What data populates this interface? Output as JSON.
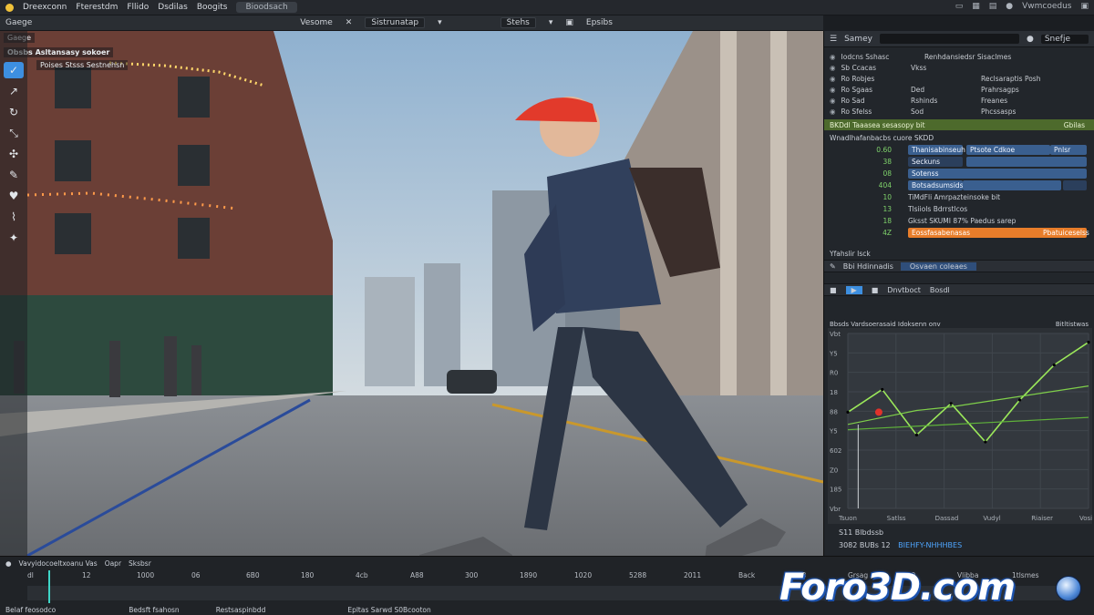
{
  "menubar": {
    "items": [
      "Dreexconn",
      "Fterestdm",
      "Fllido",
      "Dsdilas",
      "Boogits"
    ],
    "workspace": "Bioodsach",
    "right_icons": [
      "window-icon",
      "grid-icon",
      "layers-icon",
      "dot-icon",
      "layout-icon"
    ],
    "right_label": "Vwmcoedus"
  },
  "toolbar": {
    "left_label": "Gaege",
    "view_label": "Vesome",
    "mode_dropdown": "Sistrunatap",
    "shading_dropdown": "Stehs",
    "overlay_label": "Epsibs"
  },
  "viewport": {
    "header_label": "Obsbs Asltansasy sokoer",
    "sub_label": "Poises Stsss Sestnehsn",
    "tools": [
      "select-tool",
      "move-tool",
      "rotate-tool",
      "scale-tool",
      "transform-tool",
      "annotate-tool",
      "measure-tool",
      "eyedropper-tool",
      "extra-tool"
    ]
  },
  "outliner": {
    "header_label": "Samey",
    "search_placeholder": "",
    "filter_label": "Snefje",
    "rows": [
      {
        "c1": "Iodcns Sshasc",
        "c2": "",
        "c3": "Renhdansiedsr Sisaclmes"
      },
      {
        "c1": "Sb Ccacas",
        "c2": "Vkss",
        "c3": ""
      },
      {
        "c1": "Ro Robjes",
        "c2": "",
        "c3": "Reclsaraptis Posh"
      },
      {
        "c1": "Ro Sgaas",
        "c2": "Ded",
        "c3": "Prahrsagps"
      },
      {
        "c1": "Ro Sad",
        "c2": "Rshinds",
        "c3": "Freanes"
      },
      {
        "c1": "Ro Sfelss",
        "c2": "Sod",
        "c3": "Phcssasps"
      }
    ],
    "selected": {
      "label": "BKDdl Taaasea sesasopy bit",
      "right": "Gbilas"
    }
  },
  "properties": {
    "header": "Wnadlhafanbacbs cuore SKDD",
    "rows": [
      {
        "num": "0.60",
        "field1": "Thanisabinseuh",
        "field2": "Ptsote Cdkoe",
        "field3": "Pnlsr"
      },
      {
        "num": "38",
        "field1": "Seckuns",
        "field2": "",
        "field3": ""
      },
      {
        "num": "08",
        "field1": "Sotenss",
        "field2": "",
        "field3": ""
      },
      {
        "num": "404",
        "field1": "Botsadsumsidsbe",
        "field2": "",
        "field3": ""
      },
      {
        "num": "10",
        "field1": "TiMdFli Amrpazteinsoke bit",
        "field2": "",
        "field3": ""
      },
      {
        "num": "13",
        "field1": "Tlsiiols Bdrrstlcos",
        "field2": "",
        "field3": ""
      },
      {
        "num": "18",
        "field1": "Gksst SKUMI 87% Paedus sarep",
        "field2": "",
        "field3": ""
      },
      {
        "num": "4Z",
        "field1": "Eossfasabenasas",
        "field2": "Pbatuiceselss",
        "field3": ""
      }
    ]
  },
  "graph_panel": {
    "section_label": "Yfahslir Isck",
    "tab_left": "Bbi Hdinnadis",
    "tab_right": "Osvaen coleaes",
    "toolbar_left": "Dnvtboct",
    "toolbar_right": "Bosdl",
    "title": "Bbsds Vardsoerasaid Idoksenn onv",
    "corner_label": "Bitltistwas",
    "y_ticks": [
      "Vbt",
      "Y5",
      "R0",
      "18",
      "88",
      "Y5",
      "602",
      "Z0",
      "185",
      "Vbr"
    ],
    "x_ticks": [
      "Tsuon",
      "Satlss",
      "Dassad",
      "Vudyl",
      "Riaiser",
      "Vosin"
    ],
    "footer_a": "S11 Blbdssb",
    "footer_b": "3082 BUBs 12",
    "footer_c": "BIEHFY-NHHHBES",
    "green_color": "#9be85a",
    "red_marker_color": "#e0322b"
  },
  "chart_data": {
    "type": "line",
    "x": [
      0,
      1,
      2,
      3,
      4,
      5,
      6,
      7
    ],
    "series": [
      {
        "values": [
          0.55,
          0.68,
          0.42,
          0.6,
          0.38,
          0.62,
          0.82,
          0.95
        ]
      },
      {
        "values": [
          0.48,
          0.52,
          0.56,
          0.58,
          0.61,
          0.64,
          0.67,
          0.7
        ]
      },
      {
        "values": [
          0.45,
          0.46,
          0.47,
          0.48,
          0.49,
          0.5,
          0.51,
          0.52
        ]
      }
    ],
    "ylim": [
      0,
      1
    ],
    "grid": true
  },
  "timeline": {
    "label": "Vavyidocoeltxoanu Vas",
    "label2": "Oapr",
    "label3": "Sksbsr",
    "ruler": [
      "dl",
      "12",
      "1000",
      "06",
      "6B0",
      "180",
      "4cb",
      "A88",
      "300",
      "1890",
      "1020",
      "5288",
      "2011",
      "Back",
      "118",
      "Grsag",
      "520",
      "Vlibba",
      "1tlsmes"
    ],
    "bottom": [
      "Belaf feosodco",
      "Bedsft fsahosn",
      "Restsaspinbdd",
      "Epltas Sarwd S0Bcooton"
    ],
    "current_frame": 0.02
  },
  "watermark": {
    "text": "Foro3D.com"
  },
  "colors": {
    "accent_blue": "#3d8fe0",
    "selection_green": "#4d6a2c",
    "field_blue": "#3a5f8f",
    "orange": "#e87d2a",
    "panel_bg": "#22262b"
  }
}
